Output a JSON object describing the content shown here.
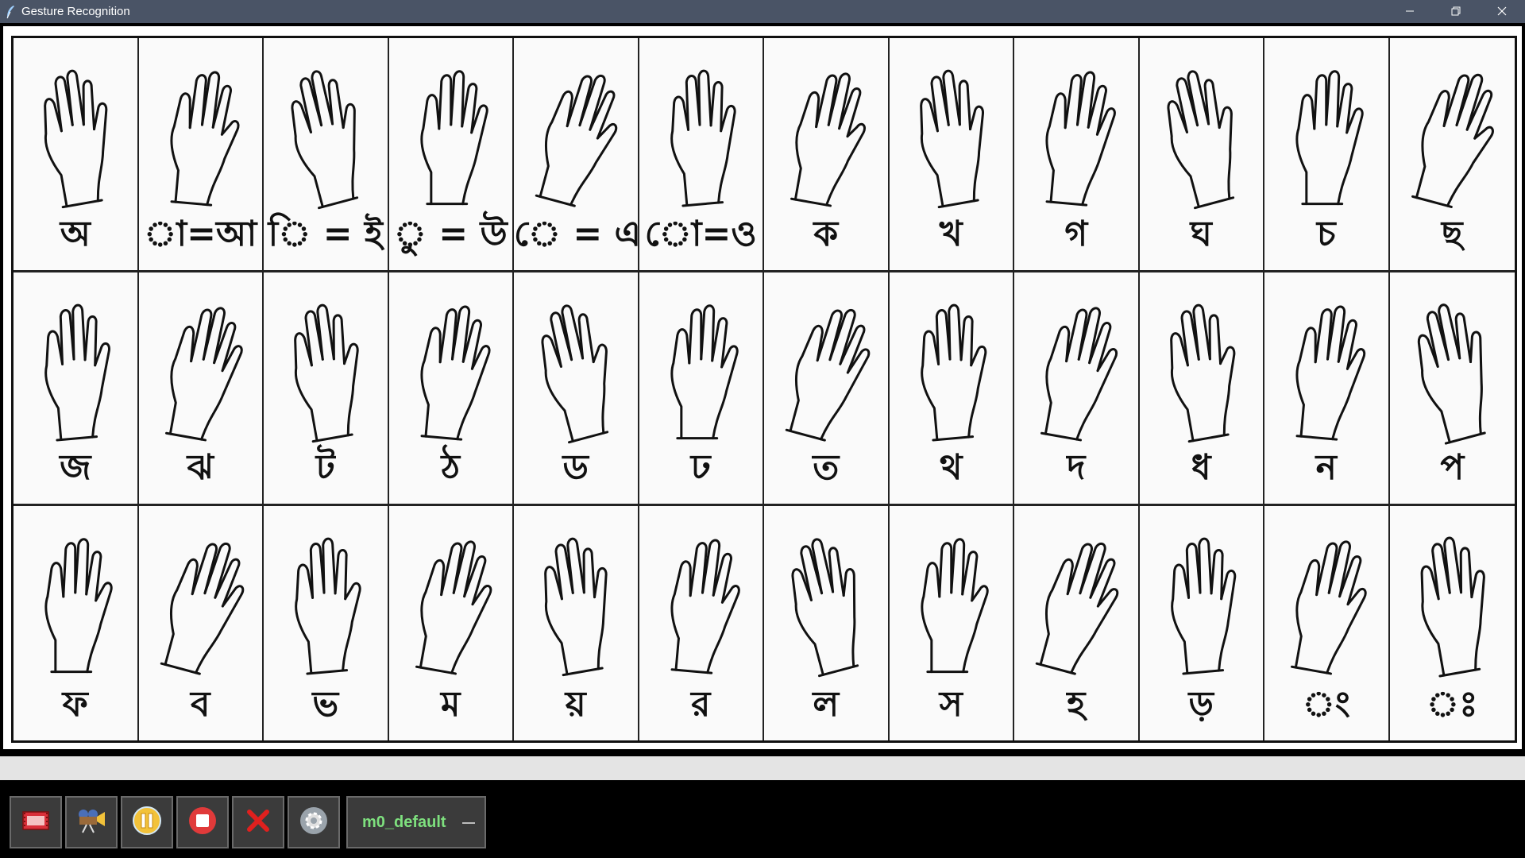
{
  "window": {
    "title": "Gesture Recognition",
    "controls": {
      "minimize": "minimize-icon",
      "restore": "restore-icon",
      "close": "close-icon"
    }
  },
  "chart": {
    "rows": [
      [
        "অ",
        "া=আ",
        "ি = ই",
        "ু = উ",
        "ে = এ",
        "ো=ও",
        "ক",
        "খ",
        "গ",
        "ঘ",
        "চ",
        "ছ"
      ],
      [
        "জ",
        "ঝ",
        "ট",
        "ঠ",
        "ড",
        "ঢ",
        "ত",
        "থ",
        "দ",
        "ধ",
        "ন",
        "প"
      ],
      [
        "ফ",
        "ব",
        "ভ",
        "ম",
        "য়",
        "র",
        "ল",
        "স",
        "হ",
        "ড়",
        "ং",
        "ঃ"
      ]
    ]
  },
  "toolbar": {
    "buttons": [
      {
        "icon": "film-icon",
        "color": "#d9303a"
      },
      {
        "icon": "camera-icon",
        "color": "#f2c23a"
      },
      {
        "icon": "pause-icon",
        "color": "#f2c23a"
      },
      {
        "icon": "stop-icon",
        "color": "#e03a3a"
      },
      {
        "icon": "close-x-icon",
        "color": "#e0201e"
      },
      {
        "icon": "settings-icon",
        "color": "#9aa3ab"
      }
    ],
    "model_name": "m0_default"
  },
  "colors": {
    "titlebar_bg": "#4a5466",
    "model_text": "#7ee07e",
    "toolbar_bg": "#000000"
  }
}
